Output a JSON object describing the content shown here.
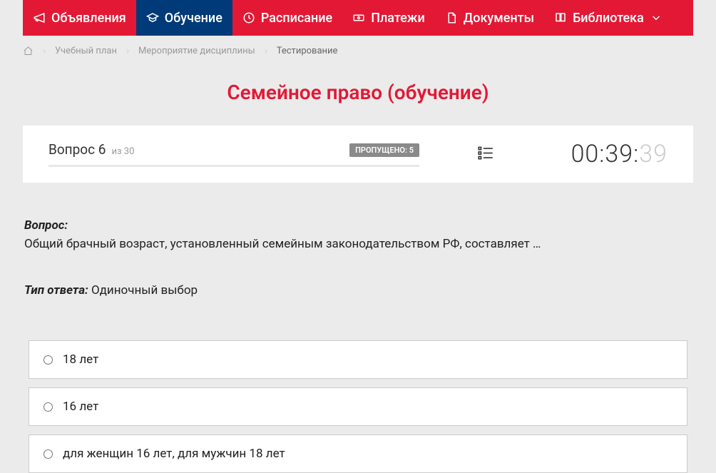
{
  "nav": {
    "announcements": "Объявления",
    "learning": "Обучение",
    "schedule": "Расписание",
    "payments": "Платежи",
    "documents": "Документы",
    "library": "Библиотека"
  },
  "breadcrumb": {
    "plan": "Учебный план",
    "event": "Мероприятие дисциплины",
    "testing": "Тестирование"
  },
  "page_title": "Семейное право (обучение)",
  "status": {
    "question_label": "Вопрос 6",
    "total": "из 30",
    "skipped": "ПРОПУЩЕНО: 5",
    "timer_main": "00:39:",
    "timer_faded": "39"
  },
  "question": {
    "label": "Вопрос:",
    "text": "Общий брачный возраст, установленный семейным законодательством РФ, составляет …",
    "answer_type_label": "Тип ответа:",
    "answer_type_value": " Одиночный выбор"
  },
  "answers": [
    {
      "text": "18 лет"
    },
    {
      "text": "16 лет"
    },
    {
      "text": "для женщин 16 лет, для мужчин 18 лет"
    }
  ]
}
